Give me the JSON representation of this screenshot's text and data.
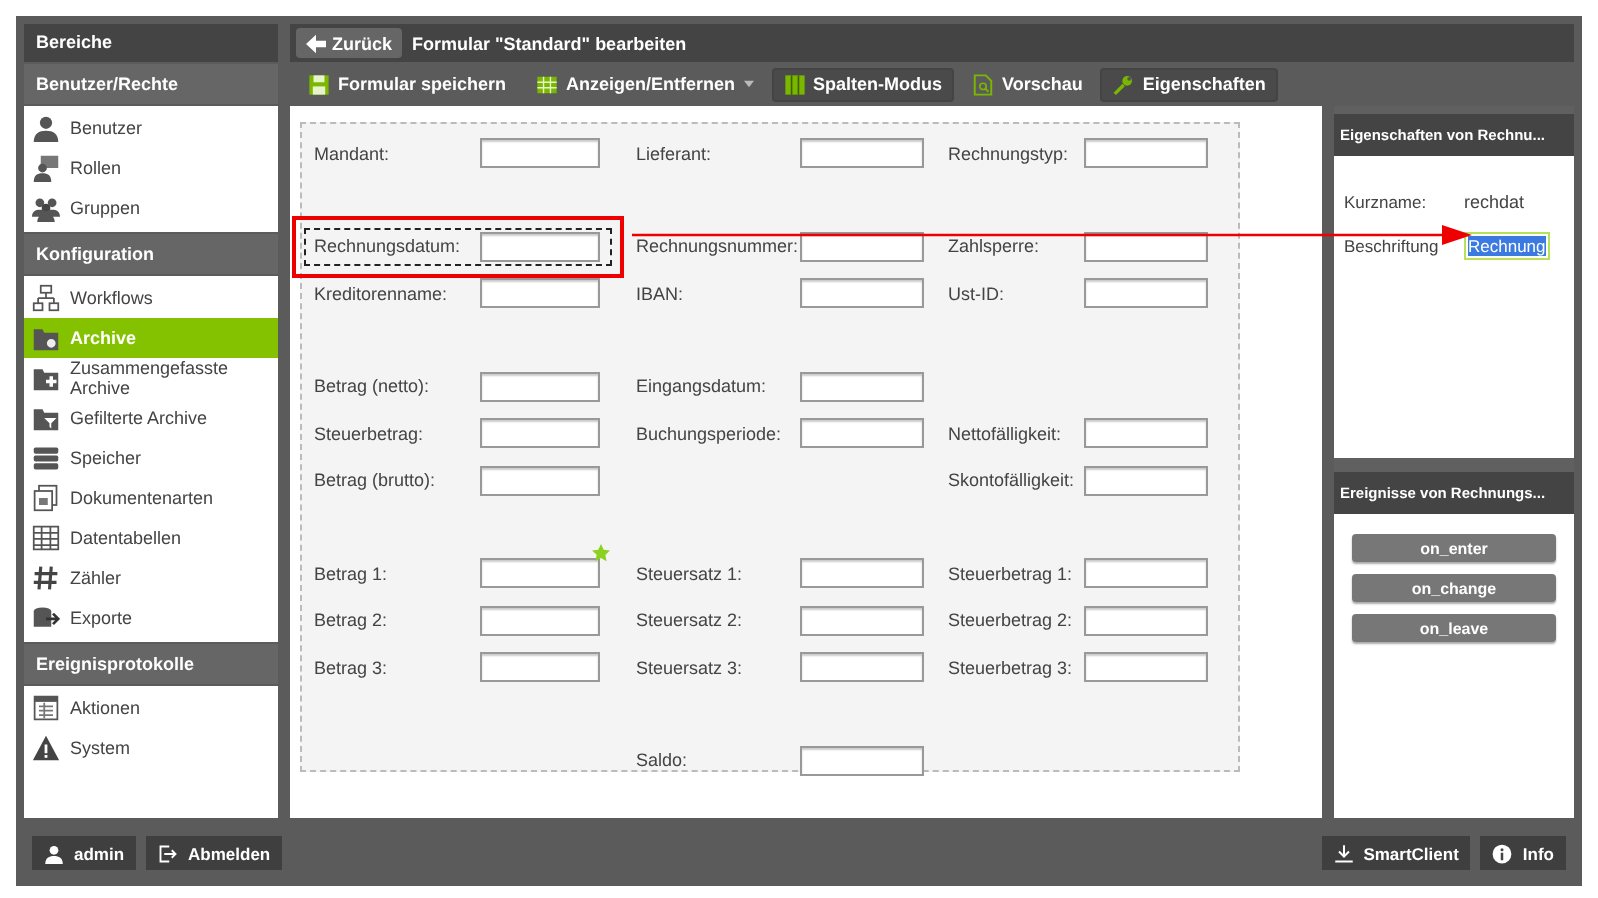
{
  "sidebar": {
    "title": "Bereiche",
    "sections": [
      {
        "title": "Benutzer/Rechte",
        "items": [
          {
            "label": "Benutzer",
            "selected": false
          },
          {
            "label": "Rollen",
            "selected": false
          },
          {
            "label": "Gruppen",
            "selected": false
          }
        ]
      },
      {
        "title": "Konfiguration",
        "items": [
          {
            "label": "Workflows",
            "selected": false
          },
          {
            "label": "Archive",
            "selected": true
          },
          {
            "label": "Zusammengefasste Archive",
            "selected": false
          },
          {
            "label": "Gefilterte Archive",
            "selected": false
          },
          {
            "label": "Speicher",
            "selected": false
          },
          {
            "label": "Dokumentenarten",
            "selected": false
          },
          {
            "label": "Datentabellen",
            "selected": false
          },
          {
            "label": "Zähler",
            "selected": false
          },
          {
            "label": "Exporte",
            "selected": false
          }
        ]
      },
      {
        "title": "Ereignisprotokolle",
        "items": [
          {
            "label": "Aktionen",
            "selected": false
          },
          {
            "label": "System",
            "selected": false
          }
        ]
      }
    ]
  },
  "header": {
    "back_button": "Zurück",
    "title": "Formular \"Standard\" bearbeiten"
  },
  "toolbar": [
    {
      "label": "Formular speichern",
      "selected": false,
      "dropdown": false
    },
    {
      "label": "Anzeigen/Entfernen",
      "selected": false,
      "dropdown": true
    },
    {
      "label": "Spalten-Modus",
      "selected": true,
      "dropdown": false
    },
    {
      "label": "Vorschau",
      "selected": false,
      "dropdown": false
    },
    {
      "label": "Eigenschaften",
      "selected": true,
      "dropdown": false
    }
  ],
  "form": {
    "groups": [
      {
        "rows": [
          [
            {
              "label": "Mandant:",
              "selected": false,
              "marked": false
            },
            {
              "label": "Lieferant:",
              "selected": false,
              "marked": false
            },
            {
              "label": "Rechnungstyp:",
              "selected": false,
              "marked": false
            }
          ]
        ]
      },
      {
        "rows": [
          [
            {
              "label": "Rechnungsdatum:",
              "selected": true,
              "marked": false
            },
            {
              "label": "Rechnungsnummer:",
              "selected": false,
              "marked": false
            },
            {
              "label": "Zahlsperre:",
              "selected": false,
              "marked": false
            }
          ],
          [
            {
              "label": "Kreditorenname:",
              "selected": false,
              "marked": false
            },
            {
              "label": "IBAN:",
              "selected": false,
              "marked": false
            },
            {
              "label": "Ust-ID:",
              "selected": false,
              "marked": false
            }
          ]
        ]
      },
      {
        "rows": [
          [
            {
              "label": "Betrag (netto):",
              "selected": false,
              "marked": false
            },
            {
              "label": "Eingangsdatum:",
              "selected": false,
              "marked": false
            },
            null
          ],
          [
            {
              "label": "Steuerbetrag:",
              "selected": false,
              "marked": false
            },
            {
              "label": "Buchungsperiode:",
              "selected": false,
              "marked": false
            },
            {
              "label": "Nettofälligkeit:",
              "selected": false,
              "marked": false
            }
          ],
          [
            {
              "label": "Betrag (brutto):",
              "selected": false,
              "marked": false
            },
            null,
            {
              "label": "Skontofälligkeit:",
              "selected": false,
              "marked": false
            }
          ]
        ]
      },
      {
        "rows": [
          [
            {
              "label": "Betrag 1:",
              "selected": false,
              "marked": true
            },
            {
              "label": "Steuersatz 1:",
              "selected": false,
              "marked": false
            },
            {
              "label": "Steuerbetrag 1:",
              "selected": false,
              "marked": false
            }
          ],
          [
            {
              "label": "Betrag 2:",
              "selected": false,
              "marked": false
            },
            {
              "label": "Steuersatz 2:",
              "selected": false,
              "marked": false
            },
            {
              "label": "Steuerbetrag 2:",
              "selected": false,
              "marked": false
            }
          ],
          [
            {
              "label": "Betrag 3:",
              "selected": false,
              "marked": false
            },
            {
              "label": "Steuersatz 3:",
              "selected": false,
              "marked": false
            },
            {
              "label": "Steuerbetrag 3:",
              "selected": false,
              "marked": false
            }
          ]
        ]
      },
      {
        "rows": [
          [
            null,
            {
              "label": "Saldo:",
              "selected": false,
              "marked": false
            },
            null
          ]
        ]
      }
    ]
  },
  "properties": {
    "title": "Eigenschaften von Rechnu...",
    "fields": [
      {
        "kind": "text",
        "label": "Kurzname:",
        "value": "rechdat"
      },
      {
        "kind": "input",
        "label": "Beschriftung",
        "value": "Rechnung"
      }
    ]
  },
  "events": {
    "title": "Ereignisse von Rechnungs...",
    "buttons": [
      "on_enter",
      "on_change",
      "on_leave"
    ]
  },
  "footer": {
    "left": [
      "admin",
      "Abmelden"
    ],
    "right": [
      "SmartClient",
      "Info"
    ]
  }
}
